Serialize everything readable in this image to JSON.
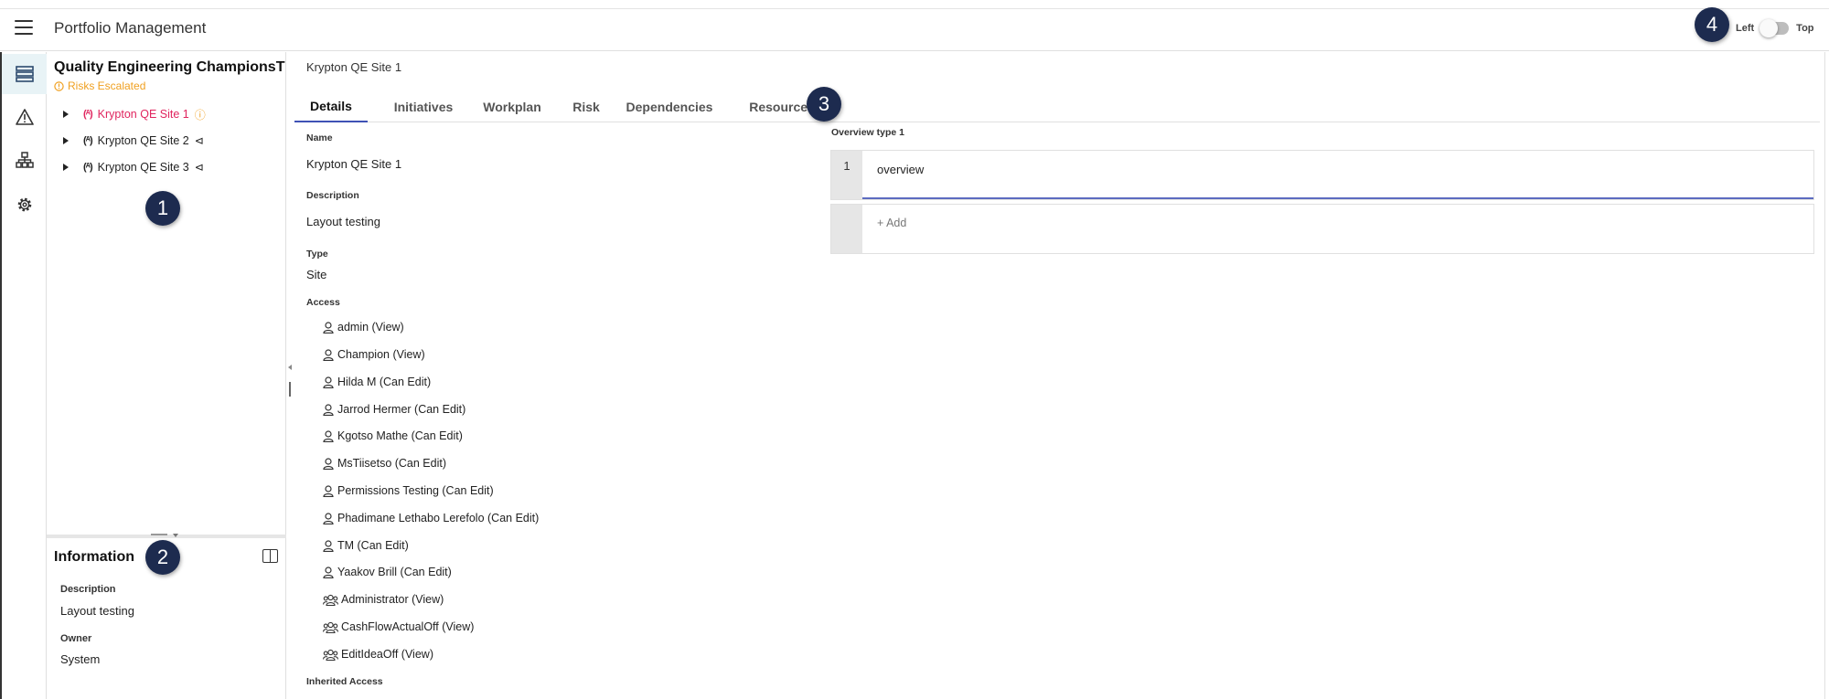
{
  "app": {
    "title": "Portfolio Management"
  },
  "layout_toggle": {
    "left_label": "Left",
    "right_label": "Top"
  },
  "markers": [
    "1",
    "2",
    "3",
    "4"
  ],
  "rail": {
    "items": [
      {
        "icon": "list-icon",
        "active": true
      },
      {
        "icon": "warning-icon",
        "active": false
      },
      {
        "icon": "hierarchy-icon",
        "active": false
      },
      {
        "icon": "gear-icon",
        "active": false
      }
    ]
  },
  "tree": {
    "portfolio_title": "Quality Engineering ChampionsT",
    "portfolio_status": "Risks Escalated",
    "status_color": "#f0a020",
    "items": [
      {
        "icon_text": "(ᴬ)",
        "label": "Krypton QE Site 1",
        "tail": "ⓘ",
        "selected": true
      },
      {
        "icon_text": "(ᴬ)",
        "label": "Krypton QE Site 2",
        "tail": "⊲",
        "selected": false
      },
      {
        "icon_text": "(ᴬ)",
        "label": "Krypton QE Site 3",
        "tail": "⊲",
        "selected": false
      }
    ]
  },
  "info": {
    "title": "Information",
    "description_label": "Description",
    "description_value": "Layout testing",
    "owner_label": "Owner",
    "owner_value": "System"
  },
  "main": {
    "breadcrumb": "Krypton QE Site 1",
    "tabs": [
      {
        "label": "Details",
        "active": true
      },
      {
        "label": "Initiatives",
        "active": false
      },
      {
        "label": "Workplan",
        "active": false
      },
      {
        "label": "Risk",
        "active": false
      },
      {
        "label": "Dependencies",
        "active": false
      },
      {
        "label": "Resources",
        "active": false
      }
    ],
    "details": {
      "name_label": "Name",
      "name_value": "Krypton QE Site 1",
      "description_label": "Description",
      "description_value": "Layout testing",
      "type_label": "Type",
      "type_value": "Site",
      "access_label": "Access",
      "access": [
        {
          "kind": "user",
          "label": "admin (View)"
        },
        {
          "kind": "user",
          "label": "Champion (View)"
        },
        {
          "kind": "user",
          "label": "Hilda M (Can Edit)"
        },
        {
          "kind": "user",
          "label": "Jarrod Hermer (Can Edit)"
        },
        {
          "kind": "user",
          "label": "Kgotso Mathe (Can Edit)"
        },
        {
          "kind": "user",
          "label": "MsTiisetso (Can Edit)"
        },
        {
          "kind": "user",
          "label": "Permissions Testing (Can Edit)"
        },
        {
          "kind": "user",
          "label": "Phadimane Lethabo Lerefolo (Can Edit)"
        },
        {
          "kind": "user",
          "label": "TM (Can Edit)"
        },
        {
          "kind": "user",
          "label": "Yaakov Brill (Can Edit)"
        },
        {
          "kind": "group",
          "label": "Administrator (View)"
        },
        {
          "kind": "group",
          "label": "CashFlowActualOff (View)"
        },
        {
          "kind": "group",
          "label": "EditIdeaOff (View)"
        }
      ],
      "inherited_access_label": "Inherited Access"
    },
    "overview": {
      "label": "Overview type 1",
      "rows": [
        {
          "num": "1",
          "text": "overview"
        }
      ],
      "add_label": "+ Add"
    }
  },
  "colors": {
    "accent": "#3f51b5",
    "selected_tree": "#e0245e",
    "marker": "#1d2b4f"
  }
}
